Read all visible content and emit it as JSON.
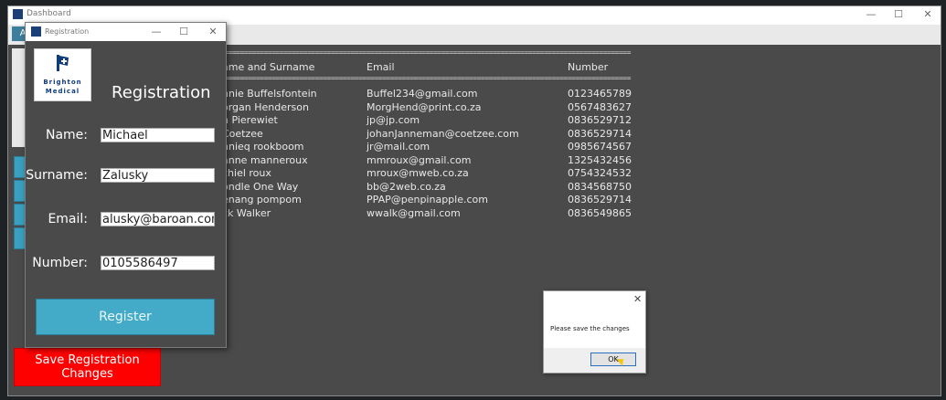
{
  "dashboard": {
    "title": "Dashboard",
    "tab_label": "A",
    "controls": {
      "minimize": "—",
      "maximize": "☐",
      "close": "✕"
    },
    "separator": "========================================================================================================",
    "columns": [
      "ame and Surname",
      "Email",
      "Number"
    ],
    "rows": [
      [
        "nnie Buffelsfontein",
        "Buffel234@gmail.com",
        "0123465789"
      ],
      [
        "organ Henderson",
        "MorgHend@print.co.za",
        "0567483627"
      ],
      [
        "n Pierewiet",
        "jp@jp.com",
        "0836529712"
      ],
      [
        "Coetzee",
        "johanJanneman@coetzee.com",
        "0836529714"
      ],
      [
        "nnieq rookboom",
        "jr@mail.com",
        "0985674567"
      ],
      [
        "anne manneroux",
        "mmroux@gmail.com",
        "1325432456"
      ],
      [
        "chiel roux",
        "mroux@mweb.co.za",
        "0754324532"
      ],
      [
        "ondle One Way",
        "bb@2web.co.za",
        "0834568750"
      ],
      [
        "enang pompom",
        "PPAP@penpinapple.com",
        "0836529714"
      ],
      [
        "ck Walker",
        "wwalk@gmail.com",
        "0836549865"
      ]
    ],
    "save_button": "Save Registration Changes"
  },
  "registration": {
    "title": "Registration",
    "heading": "Registration",
    "logo_line1": "Brighton",
    "logo_line2": "Medical",
    "fields": {
      "name": {
        "label": "Name:",
        "value": "Michael"
      },
      "surname": {
        "label": "Surname:",
        "value": "Zalusky"
      },
      "email": {
        "label": "Email:",
        "value": "alusky@baroan.com"
      },
      "number": {
        "label": "Number:",
        "value": "0105586497"
      }
    },
    "register_button": "Register"
  },
  "message_box": {
    "text": "Please save the changes",
    "ok_label": "OK",
    "close": "✕"
  },
  "colors": {
    "accent": "#43aac8",
    "danger": "#ff0000",
    "panel": "#4a4a4a"
  }
}
